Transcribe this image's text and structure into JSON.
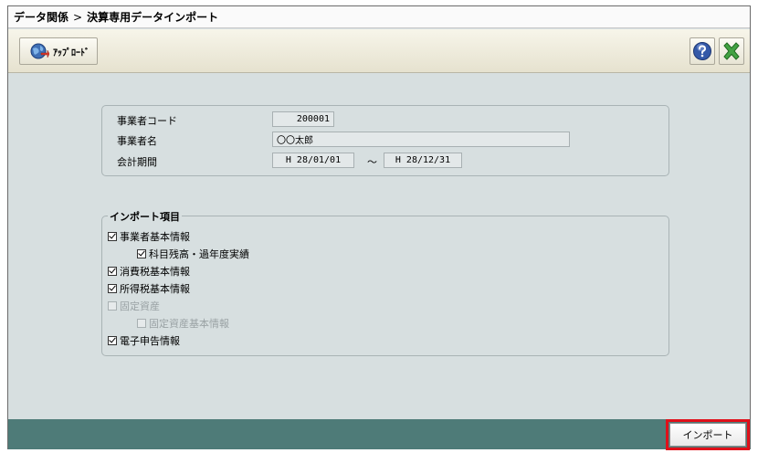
{
  "breadcrumb": {
    "parent": "データ関係",
    "separator": ">",
    "current": "決算専用データインポート"
  },
  "toolbar": {
    "upload_label": "ｱｯﾌﾟﾛｰﾄﾞ"
  },
  "info": {
    "business_code_label": "事業者コード",
    "business_code_value": "200001",
    "business_name_label": "事業者名",
    "business_name_value": "〇〇太郎",
    "period_label": "会計期間",
    "period_start": "H 28/01/01",
    "period_separator": "〜",
    "period_end": "H 28/12/31"
  },
  "import_items": {
    "legend": "インポート項目",
    "items": [
      {
        "label": "事業者基本情報",
        "checked": true,
        "disabled": false,
        "indent": 0
      },
      {
        "label": "科目残高・過年度実績",
        "checked": true,
        "disabled": false,
        "indent": 1
      },
      {
        "label": "消費税基本情報",
        "checked": true,
        "disabled": false,
        "indent": 0
      },
      {
        "label": "所得税基本情報",
        "checked": true,
        "disabled": false,
        "indent": 0
      },
      {
        "label": "固定資産",
        "checked": false,
        "disabled": true,
        "indent": 0
      },
      {
        "label": "固定資産基本情報",
        "checked": false,
        "disabled": true,
        "indent": 1
      },
      {
        "label": "電子申告情報",
        "checked": true,
        "disabled": false,
        "indent": 0
      }
    ]
  },
  "footer": {
    "import_label": "インポート",
    "highlight_color": "#e0101a"
  }
}
